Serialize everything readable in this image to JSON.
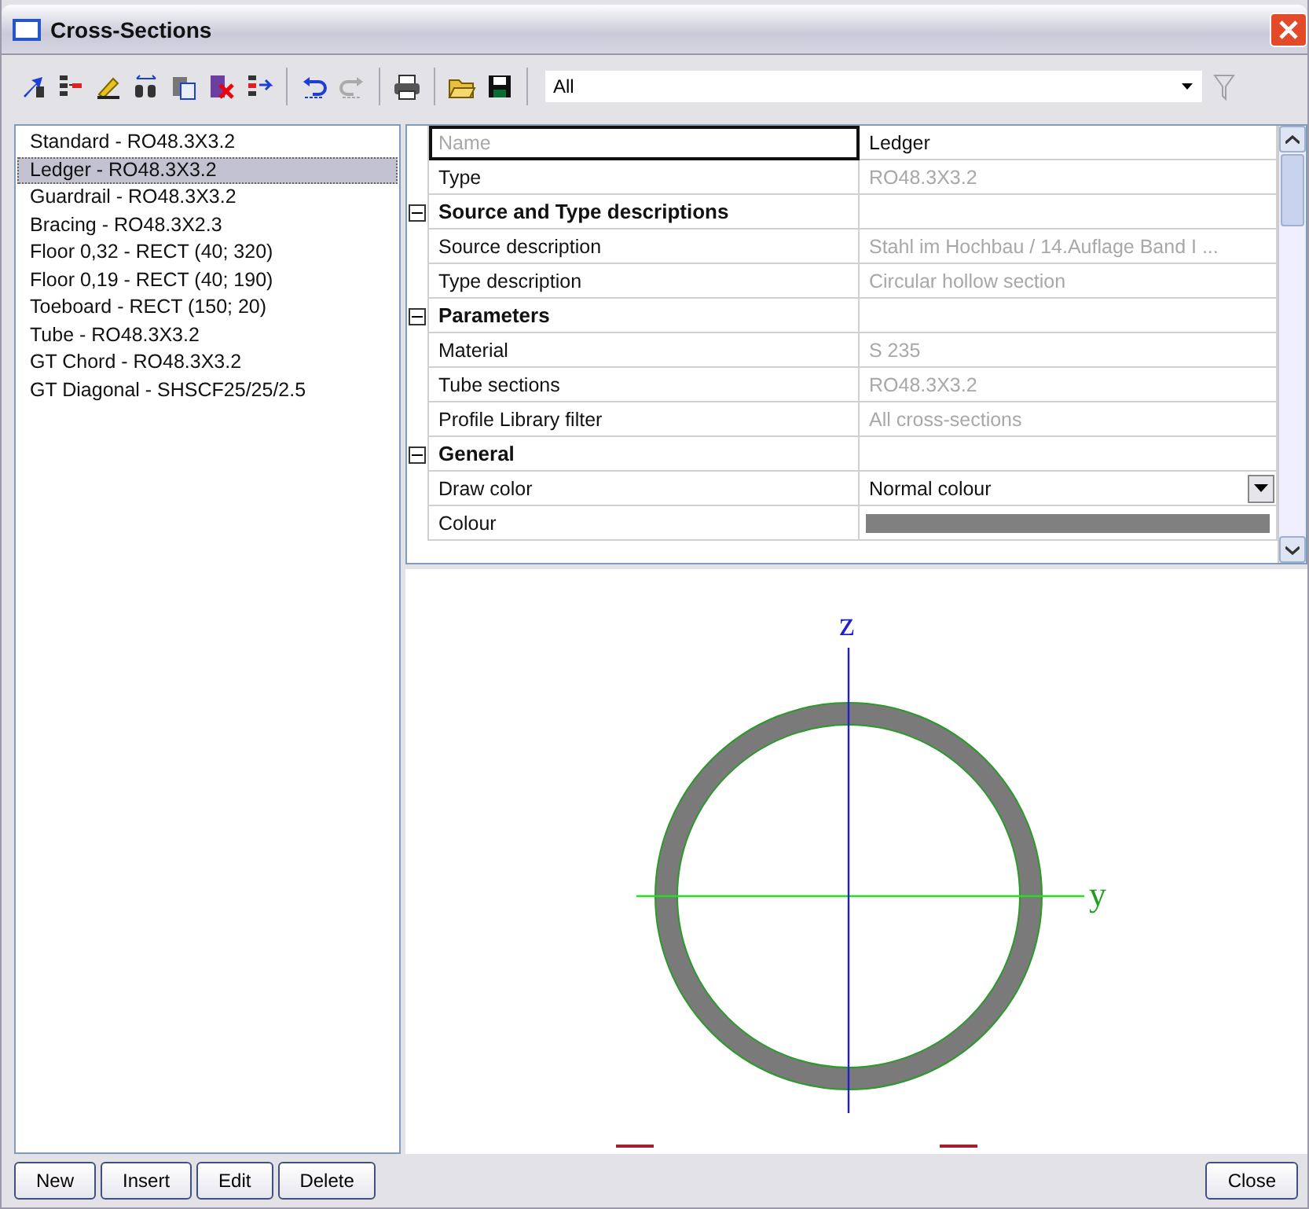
{
  "window": {
    "title": "Cross-Sections"
  },
  "toolbar": {
    "undo": {
      "disabled": false
    },
    "redo": {
      "disabled": true
    },
    "filter": {
      "value": "All"
    },
    "filter_button": {
      "disabled": true
    }
  },
  "cross_sections": [
    {
      "label": "Standard - RO48.3X3.2",
      "selected": false
    },
    {
      "label": "Ledger - RO48.3X3.2",
      "selected": true
    },
    {
      "label": "Guardrail - RO48.3X3.2",
      "selected": false
    },
    {
      "label": "Bracing - RO48.3X2.3",
      "selected": false
    },
    {
      "label": "Floor 0,32 - RECT (40; 320)",
      "selected": false
    },
    {
      "label": "Floor 0,19 - RECT (40; 190)",
      "selected": false
    },
    {
      "label": "Toeboard - RECT (150; 20)",
      "selected": false
    },
    {
      "label": "Tube - RO48.3X3.2",
      "selected": false
    },
    {
      "label": "GT Chord - RO48.3X3.2",
      "selected": false
    },
    {
      "label": "GT Diagonal - SHSCF25/25/2.5",
      "selected": false
    }
  ],
  "properties": [
    {
      "kind": "prop",
      "name": "Name",
      "value": "Ledger",
      "readonly": false,
      "selected": true
    },
    {
      "kind": "prop",
      "name": "Type",
      "value": "RO48.3X3.2",
      "readonly": true,
      "selected": false
    },
    {
      "kind": "group",
      "name": "Source and Type descriptions",
      "expanded": true
    },
    {
      "kind": "prop",
      "name": "Source description",
      "value": "Stahl im Hochbau / 14.Auflage Band I ...",
      "readonly": true,
      "selected": false
    },
    {
      "kind": "prop",
      "name": "Type description",
      "value": "Circular hollow section",
      "readonly": true,
      "selected": false
    },
    {
      "kind": "group",
      "name": "Parameters",
      "expanded": true
    },
    {
      "kind": "prop",
      "name": "Material",
      "value": "S 235",
      "readonly": true,
      "selected": false
    },
    {
      "kind": "prop",
      "name": "Tube sections",
      "value": "RO48.3X3.2",
      "readonly": true,
      "selected": false
    },
    {
      "kind": "prop",
      "name": "Profile Library filter",
      "value": "All cross-sections",
      "readonly": true,
      "selected": false
    },
    {
      "kind": "group",
      "name": "General",
      "expanded": true
    },
    {
      "kind": "dropdown",
      "name": "Draw color",
      "value": "Normal colour"
    },
    {
      "kind": "swatch",
      "name": "Colour",
      "color": "#808080"
    }
  ],
  "preview": {
    "vertical_axis": "z",
    "horizontal_axis": "y"
  },
  "buttons_left": [
    "New",
    "Insert",
    "Edit",
    "Delete"
  ],
  "buttons_right": [
    "Close"
  ]
}
